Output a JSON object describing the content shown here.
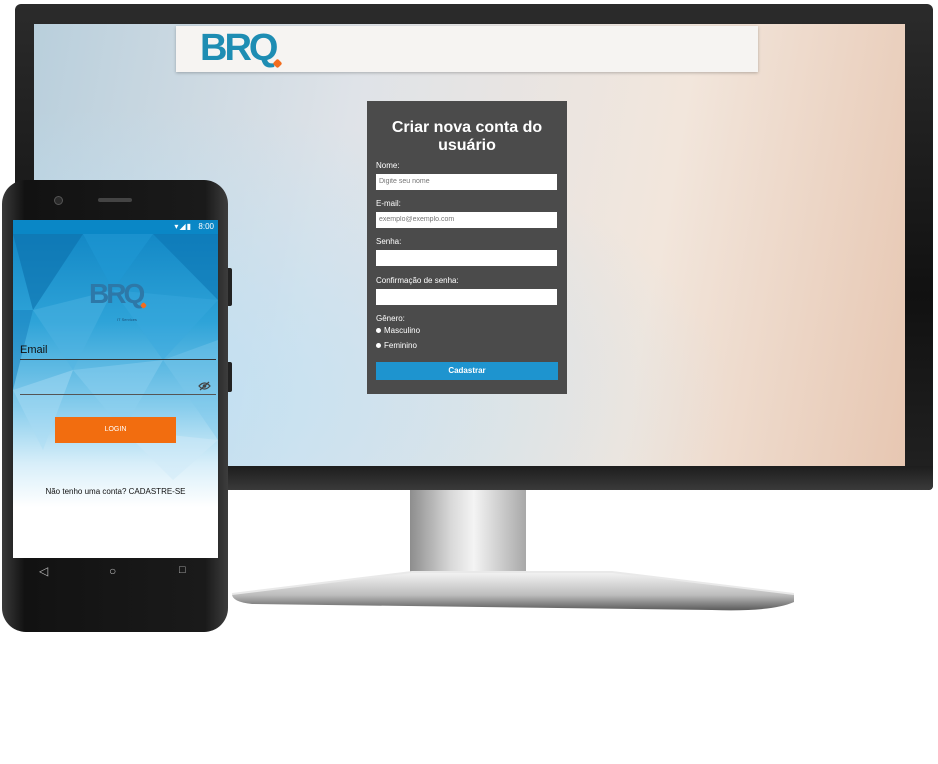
{
  "desktop": {
    "header": {
      "logo_text": "BRQ"
    },
    "form": {
      "title_line1": "Criar nova conta do",
      "title_line2": "usuário",
      "name_label": "Nome:",
      "name_placeholder": "Digite seu nome",
      "email_label": "E-mail:",
      "email_placeholder": "exemplo@exemplo.com",
      "password_label": "Senha:",
      "password_value": "",
      "confirm_label": "Confirmação de senha:",
      "confirm_value": "",
      "gender_label": "Gênero:",
      "gender_options": [
        "Masculino",
        "Feminino"
      ],
      "submit_label": "Cadastrar",
      "colors": {
        "card": "#4b4b4b",
        "button": "#1e94cf"
      }
    }
  },
  "mobile": {
    "status_bar": {
      "time": "8:00",
      "icons": [
        "wifi-icon",
        "signal-icon",
        "battery-icon"
      ]
    },
    "logo_text": "BRQ",
    "logo_subtitle": "IT Services",
    "email_label": "Email",
    "password_toggle_icon": "eye-off-icon",
    "login_label": "LOGIN",
    "signup_text": "Não tenho uma conta? CADASTRE-SE",
    "nav": [
      "back-icon",
      "home-icon",
      "recents-icon"
    ],
    "colors": {
      "login_button": "#f26d0f",
      "status_bar": "#0a87c6"
    }
  }
}
